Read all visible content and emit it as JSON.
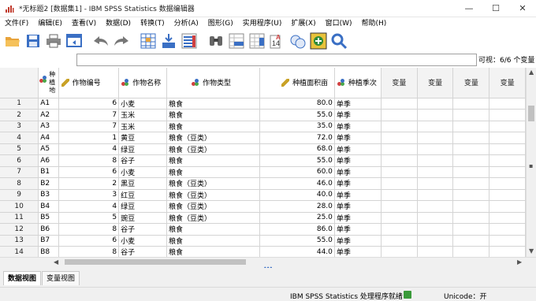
{
  "window": {
    "title": "*无标题2 [数据集1] - IBM SPSS Statistics 数据编辑器",
    "minimize": "—",
    "maximize": "☐",
    "close": "✕"
  },
  "menu": [
    "文件(F)",
    "编辑(E)",
    "查看(V)",
    "数据(D)",
    "转换(T)",
    "分析(A)",
    "图形(G)",
    "实用程序(U)",
    "扩展(X)",
    "窗口(W)",
    "帮助(H)"
  ],
  "toolbar": {
    "icons": [
      "open-folder-icon",
      "save-icon",
      "print-icon",
      "dialog-recall-icon",
      "undo-icon",
      "redo-icon",
      "goto-case-icon",
      "goto-variable-icon",
      "variables-icon",
      "find-icon",
      "insert-cases-icon",
      "split-file-icon",
      "value-labels-icon",
      "use-sets-icon",
      "search-icon"
    ]
  },
  "cell_editor": {
    "value": ""
  },
  "visible_vars": "可视：6/6 个变量",
  "columns": [
    {
      "name": "种植地",
      "type": "nominal"
    },
    {
      "name": "作物编号",
      "type": "scale"
    },
    {
      "name": "作物名称",
      "type": "nominal"
    },
    {
      "name": "作物类型",
      "type": "nominal"
    },
    {
      "name": "种植面积亩",
      "type": "scale"
    },
    {
      "name": "种植季次",
      "type": "nominal"
    }
  ],
  "empty_var_label": "变量",
  "rows": [
    [
      "1",
      "A1",
      "6",
      "小麦",
      "粮食",
      "80.0",
      "单季"
    ],
    [
      "2",
      "A2",
      "7",
      "玉米",
      "粮食",
      "55.0",
      "单季"
    ],
    [
      "3",
      "A3",
      "7",
      "玉米",
      "粮食",
      "35.0",
      "单季"
    ],
    [
      "4",
      "A4",
      "1",
      "黄豆",
      "粮食（豆类）",
      "72.0",
      "单季"
    ],
    [
      "5",
      "A5",
      "4",
      "绿豆",
      "粮食（豆类）",
      "68.0",
      "单季"
    ],
    [
      "6",
      "A6",
      "8",
      "谷子",
      "粮食",
      "55.0",
      "单季"
    ],
    [
      "7",
      "B1",
      "6",
      "小麦",
      "粮食",
      "60.0",
      "单季"
    ],
    [
      "8",
      "B2",
      "2",
      "黑豆",
      "粮食（豆类）",
      "46.0",
      "单季"
    ],
    [
      "9",
      "B3",
      "3",
      "红豆",
      "粮食（豆类）",
      "40.0",
      "单季"
    ],
    [
      "10",
      "B4",
      "4",
      "绿豆",
      "粮食（豆类）",
      "28.0",
      "单季"
    ],
    [
      "11",
      "B5",
      "5",
      "豌豆",
      "粮食（豆类）",
      "25.0",
      "单季"
    ],
    [
      "12",
      "B6",
      "8",
      "谷子",
      "粮食",
      "86.0",
      "单季"
    ],
    [
      "13",
      "B7",
      "6",
      "小麦",
      "粮食",
      "55.0",
      "单季"
    ],
    [
      "14",
      "B8",
      "8",
      "谷子",
      "粮食",
      "44.0",
      "单季"
    ]
  ],
  "tabs": [
    "数据视图",
    "变量视图"
  ],
  "status": {
    "processor": "IBM SPSS Statistics 处理程序就绪",
    "unicode": "Unicode：开"
  }
}
